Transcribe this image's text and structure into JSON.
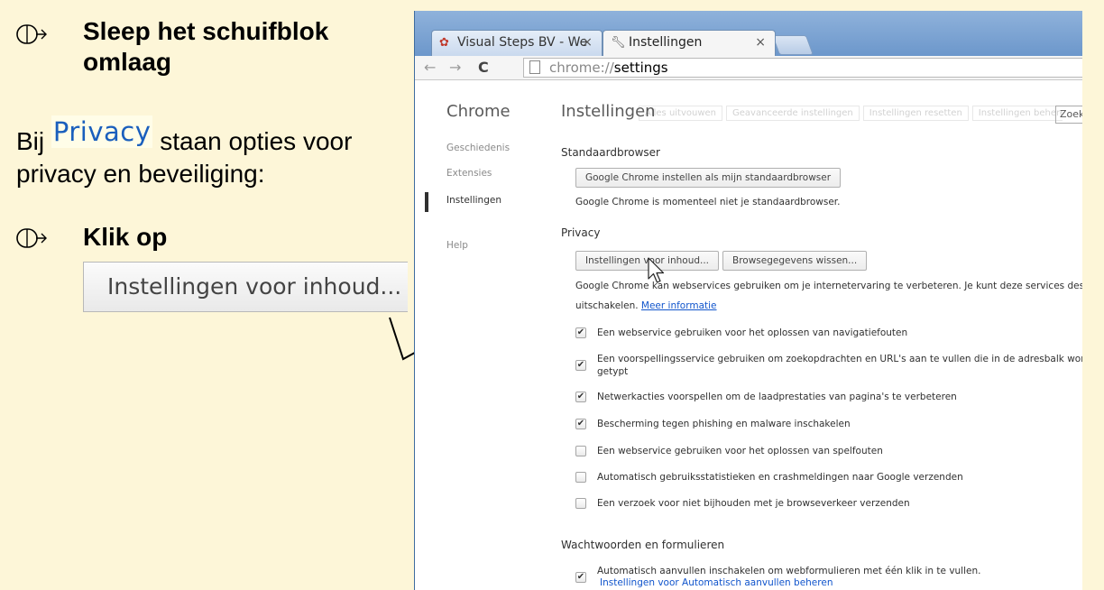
{
  "instructions": {
    "step1_title": "Sleep het schuifblok\nomlaag",
    "para_prefix": "Bij",
    "privacy_word": "Privacy",
    "para_suffix": "staan opties voor",
    "para_line2": "privacy en beveiliging:",
    "step2_title": "Klik op",
    "button_label": "Instellingen voor inhoud..."
  },
  "browser": {
    "tabs": [
      {
        "label": "Visual Steps BV - We",
        "icon": "visual-steps-favicon"
      },
      {
        "label": "Instellingen",
        "icon": "wrench-icon"
      }
    ],
    "tab_close": "×",
    "nav": {
      "back": "←",
      "forward": "→",
      "reload": "C"
    },
    "address": {
      "scheme": "chrome://",
      "path": "settings"
    }
  },
  "settings": {
    "sidebar": {
      "title": "Chrome",
      "items": [
        "Geschiedenis",
        "Extensies",
        "Instellingen",
        "Help"
      ]
    },
    "title": "Instellingen",
    "ghost_buttons": [
      "Alles uitvouwen",
      "Geavanceerde instellingen",
      "Instellingen resetten",
      "Instellingen beheren"
    ],
    "search_placeholder": "Zoek",
    "default_browser": {
      "heading": "Standaardbrowser",
      "button": "Google Chrome instellen als mijn standaardbrowser",
      "status": "Google Chrome is momenteel niet je standaardbrowser."
    },
    "privacy": {
      "heading": "Privacy",
      "content_button": "Instellingen voor inhoud...",
      "clear_button": "Browsegegevens wissen...",
      "desc_line1": "Google Chrome kan webservices gebruiken om je internetervaring te verbeteren. Je kunt deze services desge",
      "desc_line2_prefix": "uitschakelen.",
      "more_info": "Meer informatie",
      "options": [
        {
          "label": "Een webservice gebruiken voor het oplossen van navigatiefouten",
          "checked": true
        },
        {
          "label": "Een voorspellingsservice gebruiken om zoekopdrachten en URL's aan te vullen die in de adresbalk worde",
          "label2": "getypt",
          "checked": true
        },
        {
          "label": "Netwerkacties voorspellen om de laadprestaties van pagina's te verbeteren",
          "checked": true
        },
        {
          "label": "Bescherming tegen phishing en malware inschakelen",
          "checked": true
        },
        {
          "label": "Een webservice gebruiken voor het oplossen van spelfouten",
          "checked": false
        },
        {
          "label": "Automatisch gebruiksstatistieken en crashmeldingen naar Google verzenden",
          "checked": false
        },
        {
          "label": "Een verzoek voor niet bijhouden met je browseverkeer verzenden",
          "checked": false
        }
      ]
    },
    "passwords": {
      "heading": "Wachtwoorden en formulieren",
      "autofill_label": "Automatisch aanvullen inschakelen om webformulieren met één klik in te vullen.",
      "autofill_link": "Instellingen voor Automatisch aanvullen beheren",
      "autofill_checked": true
    }
  },
  "colors": {
    "panel_bg": "#fdf6d8",
    "privacy_word": "#1a5fbd",
    "link": "#1155cc",
    "window_frame": "#5b8ac1"
  }
}
